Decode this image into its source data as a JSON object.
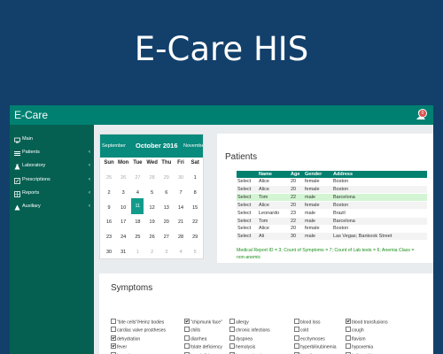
{
  "hero_title": "E-Care HIS",
  "app": {
    "brand": "E-Care",
    "notifications_count": "0",
    "colors": {
      "header": "#008071",
      "sidebar": "#066052",
      "accent": "#129b8b",
      "report_text": "#1a8f1a"
    }
  },
  "sidebar": {
    "items": [
      {
        "label": "Main",
        "icon": "monitor-icon",
        "has_submenu": false
      },
      {
        "label": "Patients",
        "icon": "list-icon",
        "has_submenu": true
      },
      {
        "label": "Laboratory",
        "icon": "flask-icon",
        "has_submenu": true
      },
      {
        "label": "Prescriptions",
        "icon": "edit-icon",
        "has_submenu": true
      },
      {
        "label": "Reports",
        "icon": "table-icon",
        "has_submenu": true
      },
      {
        "label": "Auxiliary",
        "icon": "warning-icon",
        "has_submenu": true
      }
    ]
  },
  "calendar": {
    "prev_month": "September",
    "current": "October 2016",
    "next_month": "November",
    "weekdays": [
      "Sun",
      "Mon",
      "Tue",
      "Wed",
      "Thu",
      "Fri",
      "Sat"
    ],
    "weeks": [
      [
        {
          "d": "25",
          "muted": true
        },
        {
          "d": "26",
          "muted": true
        },
        {
          "d": "27",
          "muted": true
        },
        {
          "d": "28",
          "muted": true
        },
        {
          "d": "29",
          "muted": true
        },
        {
          "d": "30",
          "muted": true
        },
        {
          "d": "1"
        }
      ],
      [
        {
          "d": "2"
        },
        {
          "d": "3"
        },
        {
          "d": "4"
        },
        {
          "d": "5"
        },
        {
          "d": "6"
        },
        {
          "d": "7"
        },
        {
          "d": "8"
        }
      ],
      [
        {
          "d": "9"
        },
        {
          "d": "10"
        },
        {
          "d": "11",
          "selected": true
        },
        {
          "d": "12"
        },
        {
          "d": "13"
        },
        {
          "d": "14"
        },
        {
          "d": "15"
        }
      ],
      [
        {
          "d": "16"
        },
        {
          "d": "17"
        },
        {
          "d": "18"
        },
        {
          "d": "19"
        },
        {
          "d": "20"
        },
        {
          "d": "21"
        },
        {
          "d": "22"
        }
      ],
      [
        {
          "d": "23"
        },
        {
          "d": "24"
        },
        {
          "d": "25"
        },
        {
          "d": "26"
        },
        {
          "d": "27"
        },
        {
          "d": "28"
        },
        {
          "d": "29"
        }
      ],
      [
        {
          "d": "30"
        },
        {
          "d": "31"
        },
        {
          "d": "1",
          "muted": true
        },
        {
          "d": "2",
          "muted": true
        },
        {
          "d": "3",
          "muted": true
        },
        {
          "d": "4",
          "muted": true
        },
        {
          "d": "5",
          "muted": true
        }
      ]
    ]
  },
  "patients": {
    "title": "Patients",
    "columns": [
      "",
      "Name",
      "Age",
      "Gender",
      "Address"
    ],
    "rows": [
      {
        "action": "Select",
        "name": "Alice",
        "age": "20",
        "gender": "female",
        "address": "Boston"
      },
      {
        "action": "Select",
        "name": "Alice",
        "age": "20",
        "gender": "female",
        "address": "Boston"
      },
      {
        "action": "Select",
        "name": "Tom",
        "age": "22",
        "gender": "male",
        "address": "Barcelona",
        "highlighted": true
      },
      {
        "action": "Select",
        "name": "Alice",
        "age": "20",
        "gender": "female",
        "address": "Boston"
      },
      {
        "action": "Select",
        "name": "Leonardo",
        "age": "23",
        "gender": "male",
        "address": "Brazil"
      },
      {
        "action": "Select",
        "name": "Tom",
        "age": "22",
        "gender": "male",
        "address": "Barcelona"
      },
      {
        "action": "Select",
        "name": "Alice",
        "age": "20",
        "gender": "female",
        "address": "Boston"
      },
      {
        "action": "Select",
        "name": "Ali",
        "age": "30",
        "gender": "male",
        "address": "Las Vegas; Bankook Street"
      }
    ],
    "report": "Medical Report ID = 3; Count of Symptoms = 7; Count of Lab tests = 6; Anemia Class = non-anemic"
  },
  "symptoms": {
    "title": "Symptoms",
    "columns": [
      [
        {
          "label": "\"bite cells\"/Heinz bodies",
          "checked": false
        },
        {
          "label": "cardiac valve prostheses",
          "checked": false
        },
        {
          "label": "dehydration",
          "checked": true
        },
        {
          "label": "fever",
          "checked": true
        },
        {
          "label": "hypoxia",
          "checked": false
        }
      ],
      [
        {
          "label": "\"chipmunk face\"",
          "checked": true
        },
        {
          "label": "chills",
          "checked": false
        },
        {
          "label": "diarrhea",
          "checked": false
        },
        {
          "label": "folate deficiency",
          "checked": false
        },
        {
          "label": "iron deficiency",
          "checked": false
        }
      ],
      [
        {
          "label": "allergy",
          "checked": false
        },
        {
          "label": "chronic infections",
          "checked": false
        },
        {
          "label": "dyspnea",
          "checked": false
        },
        {
          "label": "hemolysis",
          "checked": false
        },
        {
          "label": "iron overload",
          "checked": true
        }
      ],
      [
        {
          "label": "blood loss",
          "checked": false
        },
        {
          "label": "cold",
          "checked": false
        },
        {
          "label": "ecchymoses",
          "checked": false
        },
        {
          "label": "hyperbilirubinemia",
          "checked": false
        },
        {
          "label": "jaundice",
          "checked": true
        }
      ],
      [
        {
          "label": "blood transfusions",
          "checked": true
        },
        {
          "label": "cough",
          "checked": false
        },
        {
          "label": "flavism",
          "checked": false
        },
        {
          "label": "hypoxemia",
          "checked": false
        },
        {
          "label": "koilonychia",
          "checked": false
        }
      ]
    ]
  }
}
